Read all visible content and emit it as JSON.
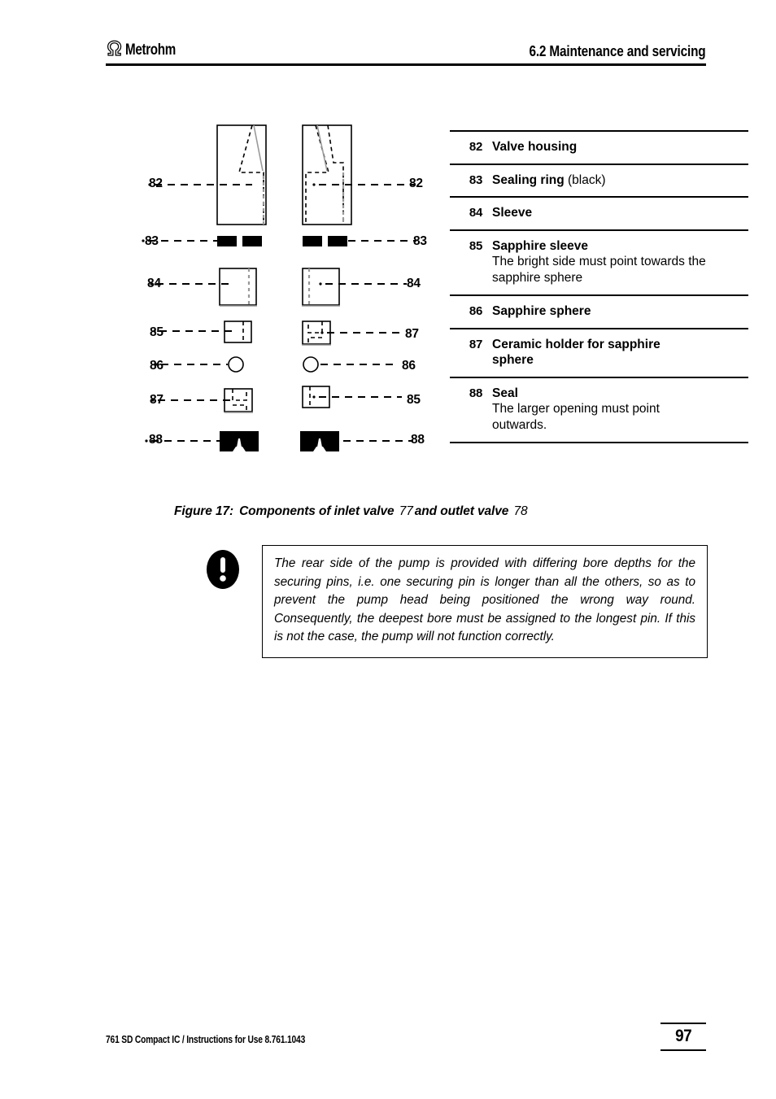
{
  "header": {
    "brand": "Metrohm",
    "logo_icon": "metrohm-omega-logo",
    "section": "6.2  Maintenance and servicing"
  },
  "figure": {
    "caption_prefix": "Figure 17:",
    "caption_text_a": "Components of inlet valve",
    "caption_ref_a": "77",
    "caption_text_b": "and outlet valve",
    "caption_ref_b": "78",
    "left_column_labels": [
      "82",
      "83",
      "84",
      "85",
      "86",
      "87",
      "88"
    ],
    "right_column_labels": [
      "82",
      "83",
      "84",
      "87",
      "86",
      "85",
      "88"
    ]
  },
  "parts_table": {
    "rows": [
      {
        "num": "82",
        "title": "Valve housing",
        "suffix": "",
        "desc": ""
      },
      {
        "num": "83",
        "title": "Sealing ring",
        "suffix": " (black)",
        "desc": ""
      },
      {
        "num": "84",
        "title": "Sleeve",
        "suffix": "",
        "desc": ""
      },
      {
        "num": "85",
        "title": "Sapphire sleeve",
        "suffix": "",
        "desc": "The bright side must point towards the sapphire sphere"
      },
      {
        "num": "86",
        "title": "Sapphire sphere",
        "suffix": "",
        "desc": ""
      },
      {
        "num": "87",
        "title": "Ceramic holder for sapphire sphere",
        "suffix": "",
        "desc": ""
      },
      {
        "num": "88",
        "title": "Seal",
        "suffix": "",
        "desc": "The larger opening must point outwards."
      }
    ]
  },
  "note": {
    "icon": "exclamation-mark-icon",
    "text": "The rear side of the pump is provided with differing bore depths for the securing pins, i.e. one securing pin is longer than all the others, so as to prevent the pump head being positioned the wrong way round. Consequently, the deepest bore must be assigned to the longest pin. If this is not the case, the pump will not function correctly."
  },
  "footer": {
    "document_line": "761 SD Compact IC / Instructions for Use  8.761.1043",
    "page_number": "97"
  },
  "colors": {
    "text": "#000000",
    "rule": "#000000",
    "page_background": "#ffffff",
    "hidden_edge_gray": "#999999"
  }
}
